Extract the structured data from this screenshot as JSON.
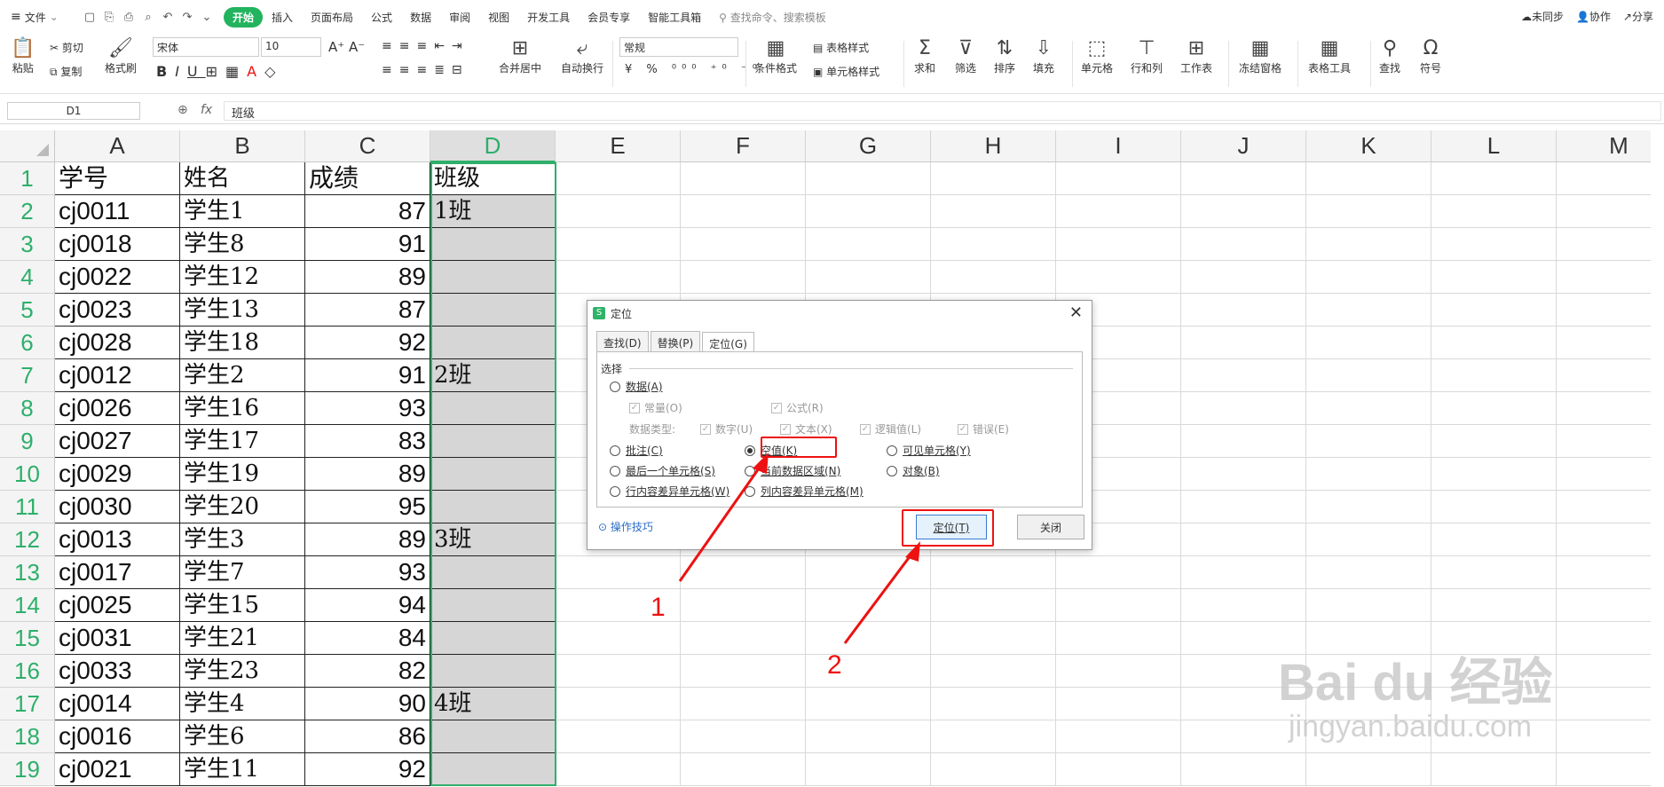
{
  "menubar": {
    "file": "文件",
    "tabs": [
      "开始",
      "插入",
      "页面布局",
      "公式",
      "数据",
      "审阅",
      "视图",
      "开发工具",
      "会员专享",
      "智能工具箱"
    ],
    "search_placeholder": "查找命令、搜索模板",
    "right": {
      "sync": "未同步",
      "collab": "协作",
      "share": "分享"
    }
  },
  "ribbon": {
    "paste": "粘贴",
    "cut": "剪切",
    "copy": "复制",
    "format_painter": "格式刷",
    "font_name": "宋体",
    "font_size": "10",
    "merge_center": "合并居中",
    "wrap_text": "自动换行",
    "number_format": "常规",
    "conditional_format": "条件格式",
    "table_style": "表格样式",
    "cell_style": "单元格样式",
    "sum": "求和",
    "filter": "筛选",
    "sort": "排序",
    "fill": "填充",
    "cells": "单元格",
    "row_col": "行和列",
    "worksheet": "工作表",
    "freeze": "冻结窗格",
    "table_tools": "表格工具",
    "find": "查找",
    "symbol": "符号"
  },
  "formula_bar": {
    "name_box": "D1",
    "fx": "fx",
    "content": "班级"
  },
  "grid": {
    "columns": [
      "A",
      "B",
      "C",
      "D",
      "E",
      "F",
      "G",
      "H",
      "I",
      "J",
      "K",
      "L",
      "M"
    ],
    "selected_column": "D",
    "rows": [
      {
        "n": "1",
        "a": "学号",
        "b": "姓名",
        "c": "成绩",
        "d": "班级"
      },
      {
        "n": "2",
        "a": "cj0011",
        "b": "学生1",
        "c": "87",
        "d": "1班"
      },
      {
        "n": "3",
        "a": "cj0018",
        "b": "学生8",
        "c": "91",
        "d": ""
      },
      {
        "n": "4",
        "a": "cj0022",
        "b": "学生12",
        "c": "89",
        "d": ""
      },
      {
        "n": "5",
        "a": "cj0023",
        "b": "学生13",
        "c": "87",
        "d": ""
      },
      {
        "n": "6",
        "a": "cj0028",
        "b": "学生18",
        "c": "92",
        "d": ""
      },
      {
        "n": "7",
        "a": "cj0012",
        "b": "学生2",
        "c": "91",
        "d": "2班"
      },
      {
        "n": "8",
        "a": "cj0026",
        "b": "学生16",
        "c": "93",
        "d": ""
      },
      {
        "n": "9",
        "a": "cj0027",
        "b": "学生17",
        "c": "83",
        "d": ""
      },
      {
        "n": "10",
        "a": "cj0029",
        "b": "学生19",
        "c": "89",
        "d": ""
      },
      {
        "n": "11",
        "a": "cj0030",
        "b": "学生20",
        "c": "95",
        "d": ""
      },
      {
        "n": "12",
        "a": "cj0013",
        "b": "学生3",
        "c": "89",
        "d": "3班"
      },
      {
        "n": "13",
        "a": "cj0017",
        "b": "学生7",
        "c": "93",
        "d": ""
      },
      {
        "n": "14",
        "a": "cj0025",
        "b": "学生15",
        "c": "94",
        "d": ""
      },
      {
        "n": "15",
        "a": "cj0031",
        "b": "学生21",
        "c": "84",
        "d": ""
      },
      {
        "n": "16",
        "a": "cj0033",
        "b": "学生23",
        "c": "82",
        "d": ""
      },
      {
        "n": "17",
        "a": "cj0014",
        "b": "学生4",
        "c": "90",
        "d": "4班"
      },
      {
        "n": "18",
        "a": "cj0016",
        "b": "学生6",
        "c": "86",
        "d": ""
      },
      {
        "n": "19",
        "a": "cj0021",
        "b": "学生11",
        "c": "92",
        "d": ""
      }
    ]
  },
  "dialog": {
    "title": "定位",
    "tabs": [
      "查找(D)",
      "替换(P)",
      "定位(G)"
    ],
    "active_tab": "定位(G)",
    "section": "选择",
    "data": "数据(A)",
    "constants": "常量(O)",
    "formulas": "公式(R)",
    "data_type_label": "数据类型:",
    "numbers": "数字(U)",
    "text": "文本(X)",
    "logical": "逻辑值(L)",
    "errors": "错误(E)",
    "comments": "批注(C)",
    "blanks": "空值(K)",
    "visible_cells": "可见单元格(Y)",
    "last_cell": "最后一个单元格(S)",
    "current_region": "当前数据区域(N)",
    "objects": "对象(B)",
    "row_diff": "行内容差异单元格(W)",
    "col_diff": "列内容差异单元格(M)",
    "tips": "操作技巧",
    "ok": "定位(T)",
    "close": "关闭"
  },
  "annotations": {
    "label1": "1",
    "label2": "2"
  },
  "watermark": {
    "brand": "Bai du 经验",
    "url": "jingyan.baidu.com"
  },
  "colors": {
    "accent": "#22b35e",
    "annotation": "#e11111",
    "selected_col": "#2eaf6a"
  }
}
